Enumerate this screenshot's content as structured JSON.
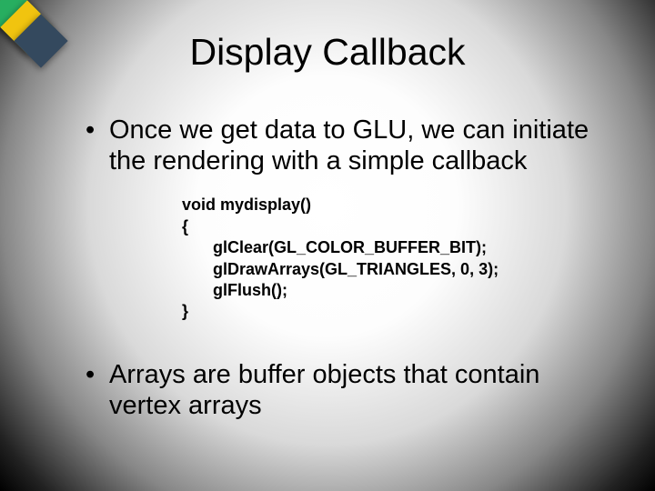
{
  "title": "Display Callback",
  "bullets": {
    "b1": "Once we get data to GLU, we can initiate the rendering with a simple callback",
    "b2": "Arrays are buffer objects that contain vertex arrays"
  },
  "code": {
    "l1": "void mydisplay()",
    "l2": "{",
    "l3": "glClear(GL_COLOR_BUFFER_BIT);",
    "l4": "glDrawArrays(GL_TRIANGLES, 0, 3);",
    "l5": "glFlush();",
    "l6": "}"
  }
}
